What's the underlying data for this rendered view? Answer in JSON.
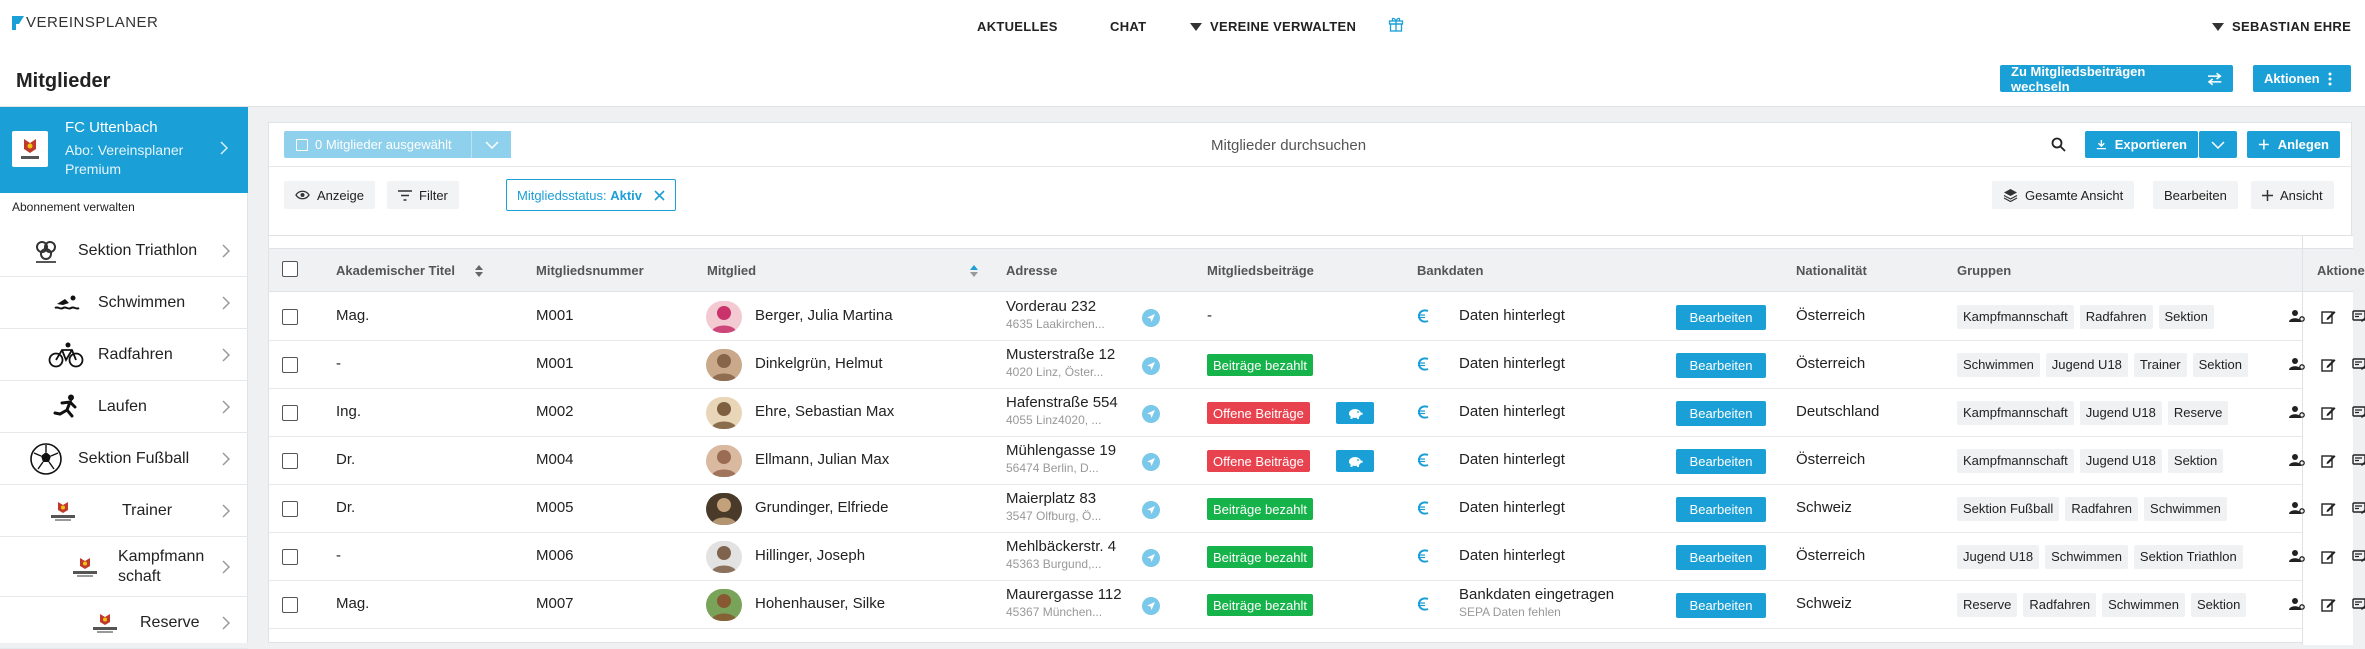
{
  "brand": {
    "name": "VEREINSPLANER",
    "accent": "#1a9fd6"
  },
  "topnav": {
    "aktuelles": "AKTUELLES",
    "chat": "CHAT",
    "vereine": "VEREINE VERWALTEN",
    "user": "SEBASTIAN EHRE"
  },
  "page": {
    "title": "Mitglieder",
    "switch_btn": "Zu Mitgliedsbeiträgen wechseln",
    "actions_btn": "Aktionen"
  },
  "club": {
    "name": "FC Uttenbach",
    "abo": "Abo: Vereinsplaner Premium",
    "manage": "Abonnement verwalten",
    "logo_text": "FC Uttenbach"
  },
  "sidebar": [
    {
      "label": "Sektion Triathlon",
      "icon": "triathlon-icon"
    },
    {
      "label": "Schwimmen",
      "icon": "swimmer-icon"
    },
    {
      "label": "Radfahren",
      "icon": "bicycle-icon"
    },
    {
      "label": "Laufen",
      "icon": "runner-icon"
    },
    {
      "label": "Sektion Fußball",
      "icon": "soccer-ball-icon"
    },
    {
      "label": "Trainer",
      "icon": "team-logo-icon"
    },
    {
      "label": "Kampfmann schaft",
      "icon": "team-logo-icon"
    },
    {
      "label": "Reserve",
      "icon": "team-logo-icon"
    }
  ],
  "toolbar": {
    "selected": "0 Mitglieder ausgewählt",
    "search_placeholder": "Mitglieder durchsuchen",
    "export": "Exportieren",
    "create": "Anlegen",
    "view": "Anzeige",
    "filter": "Filter",
    "filter_label": "Mitgliedsstatus:",
    "filter_value": "Aktiv",
    "total_view": "Gesamte Ansicht",
    "edit": "Bearbeiten",
    "add_view": "Ansicht"
  },
  "columns": {
    "title": "Akademischer Titel",
    "number": "Mitgliedsnummer",
    "member": "Mitglied",
    "address": "Adresse",
    "fees": "Mitgliedsbeiträge",
    "bank": "Bankdaten",
    "nationality": "Nationalität",
    "groups": "Gruppen",
    "actions": "Aktionen"
  },
  "status_colors": {
    "paid": "#16b34a",
    "open": "#e8424f"
  },
  "rows": [
    {
      "title": "Mag.",
      "number": "M001",
      "name": "Berger, Julia Martina",
      "street": "Vorderau 232",
      "city": "4635 Laakirchen...",
      "fee": "-",
      "fee_status": "none",
      "bank": "Daten hinterlegt",
      "bank_sub": "",
      "edit": "Bearbeiten",
      "nation": "Österreich",
      "groups": [
        "Kampfmannschaft",
        "Radfahren",
        "Sektion"
      ],
      "avatar_bg": "#f3c9d2",
      "avatar_fg": "#c2185b"
    },
    {
      "title": "-",
      "number": "M001",
      "name": "Dinkelgrün, Helmut",
      "street": "Musterstraße 12",
      "city": "4020 Linz, Öster...",
      "fee": "Beiträge bezahlt",
      "fee_status": "paid",
      "bank": "Daten hinterlegt",
      "bank_sub": "",
      "edit": "Bearbeiten",
      "nation": "Österreich",
      "groups": [
        "Schwimmen",
        "Jugend U18",
        "Trainer",
        "Sektion"
      ],
      "avatar_bg": "#c9a98a",
      "avatar_fg": "#7a5a3c"
    },
    {
      "title": "Ing.",
      "number": "M002",
      "name": "Ehre, Sebastian Max",
      "street": "Hafenstraße 554",
      "city": "4055 Linz4020, ...",
      "fee": "Offene Beiträge",
      "fee_status": "open",
      "bank": "Daten hinterlegt",
      "bank_sub": "",
      "edit": "Bearbeiten",
      "nation": "Deutschland",
      "groups": [
        "Kampfmannschaft",
        "Jugend U18",
        "Reserve"
      ],
      "avatar_bg": "#e9d6b8",
      "avatar_fg": "#6b4b2a"
    },
    {
      "title": "Dr.",
      "number": "M004",
      "name": "Ellmann, Julian Max",
      "street": "Mühlengasse 19",
      "city": "56474 Berlin, D...",
      "fee": "Offene Beiträge",
      "fee_status": "open",
      "bank": "Daten hinterlegt",
      "bank_sub": "",
      "edit": "Bearbeiten",
      "nation": "Österreich",
      "groups": [
        "Kampfmannschaft",
        "Jugend U18",
        "Sektion"
      ],
      "avatar_bg": "#d9b9a0",
      "avatar_fg": "#8d5e45"
    },
    {
      "title": "Dr.",
      "number": "M005",
      "name": "Grundinger, Elfriede",
      "street": "Maierplatz 83",
      "city": "3547 Olfburg, Ö...",
      "fee": "Beiträge bezahlt",
      "fee_status": "paid",
      "bank": "Daten hinterlegt",
      "bank_sub": "",
      "edit": "Bearbeiten",
      "nation": "Schweiz",
      "groups": [
        "Sektion Fußball",
        "Radfahren",
        "Schwimmen"
      ],
      "avatar_bg": "#4a3a2a",
      "avatar_fg": "#d8b48a"
    },
    {
      "title": "-",
      "number": "M006",
      "name": "Hillinger, Joseph",
      "street": "Mehlbäckerstr. 4",
      "city": "45363 Burgund,...",
      "fee": "Beiträge bezahlt",
      "fee_status": "paid",
      "bank": "Daten hinterlegt",
      "bank_sub": "",
      "edit": "Bearbeiten",
      "nation": "Österreich",
      "groups": [
        "Jugend U18",
        "Schwimmen",
        "Sektion Triathlon"
      ],
      "avatar_bg": "#e2e2e2",
      "avatar_fg": "#6d4c33"
    },
    {
      "title": "Mag.",
      "number": "M007",
      "name": "Hohenhauser, Silke",
      "street": "Maurergasse 112",
      "city": "45367 München...",
      "fee": "Beiträge bezahlt",
      "fee_status": "paid",
      "bank": "Bankdaten eingetragen",
      "bank_sub": "SEPA Daten fehlen",
      "edit": "Bearbeiten",
      "nation": "Schweiz",
      "groups": [
        "Reserve",
        "Radfahren",
        "Schwimmen",
        "Sektion"
      ],
      "avatar_bg": "#7aa35a",
      "avatar_fg": "#8a4b2b"
    }
  ]
}
